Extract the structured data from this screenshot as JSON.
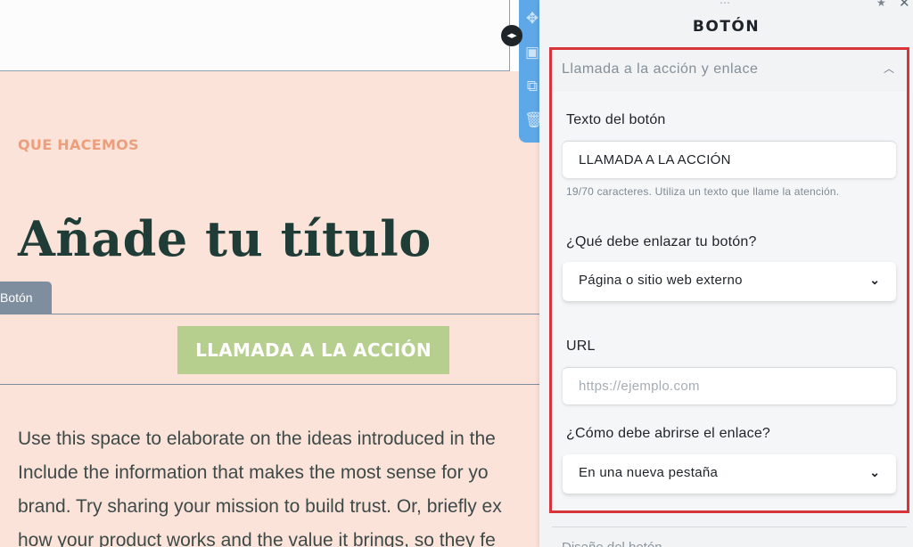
{
  "canvas": {
    "eyebrow": "QUE HACEMOS",
    "headline": "Añade tu título",
    "selection_label": "Botón",
    "cta_label": "LLAMADA A LA ACCIÓN",
    "body_lines": [
      "Use this space to elaborate on the ideas introduced in the",
      "Include the information that makes the most sense for yo",
      "brand. Try sharing your mission to build trust. Or, briefly ex",
      "how your product works and the value it brings, so they fe"
    ],
    "toolbar_icons": [
      "move-icon",
      "save-icon",
      "duplicate-icon",
      "trash-icon"
    ]
  },
  "panel": {
    "title": "BOTÓN",
    "section_header": "Llamada a la acción y enlace",
    "button_text_label": "Texto del botón",
    "button_text_value": "LLAMADA A LA ACCIÓN",
    "helper_text": "19/70 caracteres. Utiliza un texto que llame la atención.",
    "link_label": "¿Qué debe enlazar tu botón?",
    "link_value": "Página o sitio web externo",
    "url_label": "URL",
    "url_placeholder": "https://ejemplo.com",
    "open_label": "¿Cómo debe abrirse el enlace?",
    "open_value": "En una nueva pestaña",
    "next_section": "Diseño del botón"
  },
  "colors": {
    "highlight": "#d9343a",
    "cta": "#b6cf8e",
    "headline": "#1f3d36",
    "eyebrow": "#ec9f7c",
    "toolbar": "#5fa8e7"
  }
}
